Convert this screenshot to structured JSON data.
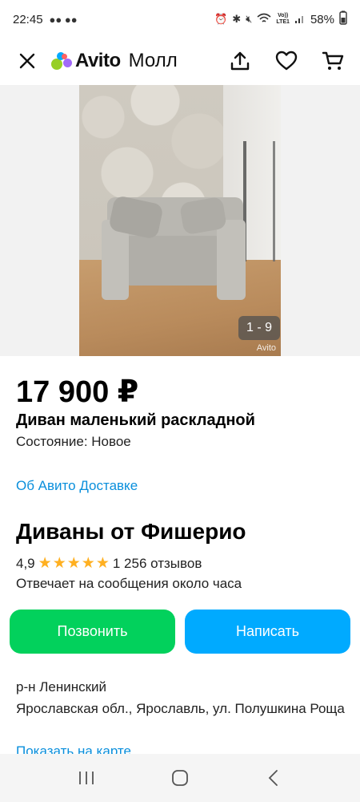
{
  "status_bar": {
    "time": "22:45",
    "network_label": "Vo))\nLTE1",
    "battery": "58%"
  },
  "app_bar": {
    "logo_primary": "Avito",
    "logo_secondary": "Молл",
    "icons": [
      "close-icon",
      "share-icon",
      "heart-icon",
      "cart-icon"
    ],
    "logo_colors": [
      "#00aaff",
      "#97cf26",
      "#ff6163",
      "#a169f7"
    ]
  },
  "gallery": {
    "counter": "1 - 9",
    "watermark": "Avito"
  },
  "listing": {
    "price": "17 900 ₽",
    "title": "Диван маленький раскладной",
    "condition": "Состояние: Новое",
    "delivery_link": "Об Авито Доставке"
  },
  "seller": {
    "name": "Диваны от Фишерио",
    "rating": "4,9",
    "stars": 5,
    "reviews": "1 256 отзывов",
    "response_time": "Отвечает на сообщения около часа"
  },
  "actions": {
    "call": "Позвонить",
    "write": "Написать",
    "call_color": "#02d15c",
    "write_color": "#00aaff"
  },
  "location": {
    "district": "р-н Ленинский",
    "address": "Ярославская обл., Ярославль, ул. Полушкина Роща",
    "map_link": "Показать на карте"
  }
}
